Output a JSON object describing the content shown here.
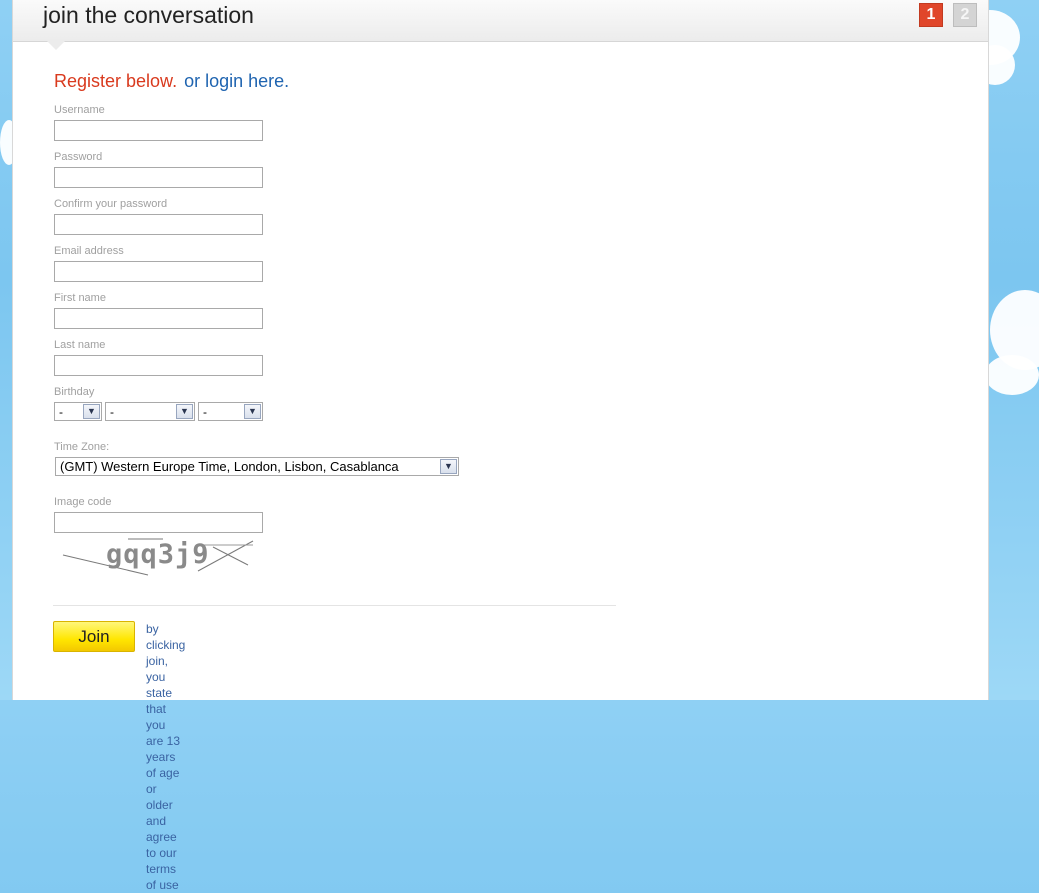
{
  "header": {
    "title": "join the conversation",
    "steps": [
      "1",
      "2"
    ],
    "active_step": 1
  },
  "intro": {
    "register": "Register below.",
    "login": "or login here."
  },
  "form": {
    "username_label": "Username",
    "password_label": "Password",
    "confirm_label": "Confirm your password",
    "email_label": "Email address",
    "first_name_label": "First name",
    "last_name_label": "Last name",
    "birthday_label": "Birthday",
    "birthday_day": "-",
    "birthday_month": "-",
    "birthday_year": "-",
    "timezone_label": "Time Zone:",
    "timezone_value": "(GMT) Western Europe Time, London, Lisbon, Casablanca",
    "image_code_label": "Image code",
    "captcha_text": "gqq3j9"
  },
  "footer": {
    "join_label": "Join",
    "terms_line1": "by clicking join, you state that you are 13 years of age or older",
    "terms_line2": "and agree to our terms of use"
  },
  "colors": {
    "accent_red": "#d93a1e",
    "link_blue": "#1f64b0",
    "join_yellow": "#ffe600",
    "sky": "#7cc6f0"
  }
}
